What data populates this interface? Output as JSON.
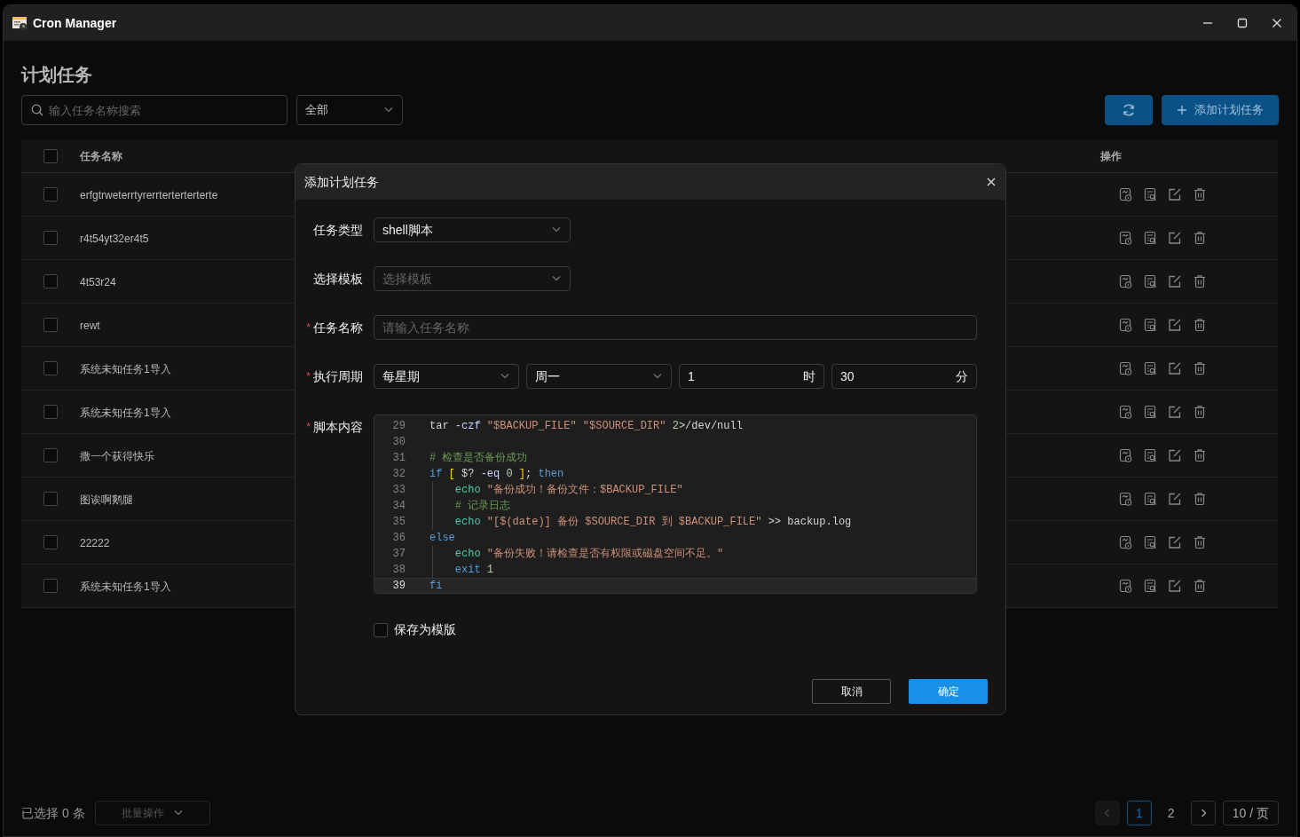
{
  "window": {
    "title": "Cron Manager"
  },
  "page": {
    "title": "计划任务"
  },
  "toolbar": {
    "search": {
      "placeholder": "输入任务名称搜索"
    },
    "filter": {
      "value": "全部"
    },
    "add_button": "添加计划任务"
  },
  "table": {
    "header_checked": false,
    "columns": [
      "任务名称",
      "操作"
    ],
    "rows": [
      {
        "name": "erfgtrweterrtyrerrterterterterte",
        "checked": false
      },
      {
        "name": "r4t54yt32er4t5",
        "checked": false
      },
      {
        "name": "4t53r24",
        "checked": false
      },
      {
        "name": "rewt",
        "checked": false
      },
      {
        "name": "系统未知任务1导入",
        "checked": false
      },
      {
        "name": "系统未知任务1导入",
        "checked": false
      },
      {
        "name": "撒一个获得快乐",
        "checked": false
      },
      {
        "name": "图诶啊鹅腿",
        "checked": false
      },
      {
        "name": "22222",
        "checked": false
      },
      {
        "name": "系统未知任务1导入",
        "checked": false
      }
    ]
  },
  "footer": {
    "selection": "已选择 0 条",
    "batch_button": "批量操作",
    "pagination": {
      "prev_disabled": true,
      "pages": [
        {
          "label": "1",
          "selected": true
        },
        {
          "label": "2",
          "selected": false
        }
      ],
      "page_size": "10 / 页"
    }
  },
  "dialog": {
    "title": "添加计划任务",
    "task_type": {
      "label": "任务类型",
      "value": "shell脚本"
    },
    "template": {
      "label": "选择模板",
      "placeholder": "选择模板"
    },
    "name": {
      "label": "任务名称",
      "required_mark": "*",
      "placeholder": "请输入任务名称"
    },
    "period": {
      "label": "执行周期",
      "required_mark": "*",
      "frequency": "每星期",
      "weekday": "周一",
      "hour": {
        "value": "1",
        "unit": "时"
      },
      "minute": {
        "value": "30",
        "unit": "分"
      }
    },
    "script": {
      "label": "脚本内容",
      "required_mark": "*",
      "lines": [
        {
          "number": "29",
          "guide": false,
          "current": false,
          "tokens": [
            {
              "kind": "plain",
              "text": "tar "
            },
            {
              "kind": "flag",
              "text": "-czf"
            },
            {
              "kind": "string",
              "text": " \"$BACKUP_FILE\""
            },
            {
              "kind": "string",
              "text": " \"$SOURCE_DIR\""
            },
            {
              "kind": "number",
              "text": " 2"
            },
            {
              "kind": "plain",
              "text": ">/dev/null"
            }
          ]
        },
        {
          "number": "30",
          "guide": false,
          "current": false
        },
        {
          "number": "31",
          "guide": false,
          "current": false,
          "tokens": [
            {
              "kind": "comment",
              "text": "# 检查是否备份成功"
            }
          ]
        },
        {
          "number": "32",
          "guide": false,
          "current": false,
          "tokens": [
            {
              "kind": "keyword",
              "text": "if"
            },
            {
              "kind": "bracket",
              "text": " ["
            },
            {
              "kind": "plain",
              "text": " $? "
            },
            {
              "kind": "flag",
              "text": "-eq"
            },
            {
              "kind": "number",
              "text": " 0"
            },
            {
              "kind": "bracket",
              "text": " ]"
            },
            {
              "kind": "plain",
              "text": "; "
            },
            {
              "kind": "keyword",
              "text": "then"
            }
          ]
        },
        {
          "number": "33",
          "guide": true,
          "current": false,
          "tokens": [
            {
              "kind": "command",
              "text": "    echo"
            },
            {
              "kind": "string",
              "text": " \"备份成功！备份文件：$BACKUP_FILE\""
            }
          ]
        },
        {
          "number": "34",
          "guide": true,
          "current": false,
          "tokens": [
            {
              "kind": "comment",
              "text": "    # 记录日志"
            }
          ]
        },
        {
          "number": "35",
          "guide": true,
          "current": false,
          "tokens": [
            {
              "kind": "command",
              "text": "    echo"
            },
            {
              "kind": "string",
              "text": " \"[$(date)] 备份 $SOURCE_DIR 到 $BACKUP_FILE\""
            },
            {
              "kind": "plain",
              "text": " >> backup.log"
            }
          ]
        },
        {
          "number": "36",
          "guide": false,
          "current": false,
          "tokens": [
            {
              "kind": "keyword",
              "text": "else"
            }
          ]
        },
        {
          "number": "37",
          "guide": true,
          "current": false,
          "tokens": [
            {
              "kind": "command",
              "text": "    echo"
            },
            {
              "kind": "string",
              "text": " \"备份失败！请检查是否有权限或磁盘空间不足。\""
            }
          ]
        },
        {
          "number": "38",
          "guide": true,
          "current": false,
          "tokens": [
            {
              "kind": "keyword",
              "text": "    exit"
            },
            {
              "kind": "number",
              "text": " 1"
            }
          ]
        },
        {
          "number": "39",
          "guide": false,
          "current": true,
          "tokens": [
            {
              "kind": "keyword",
              "text": "fi"
            }
          ]
        }
      ]
    },
    "save_template": {
      "label": "保存为模版",
      "checked": false
    },
    "buttons": {
      "cancel": "取消",
      "ok": "确定"
    }
  }
}
